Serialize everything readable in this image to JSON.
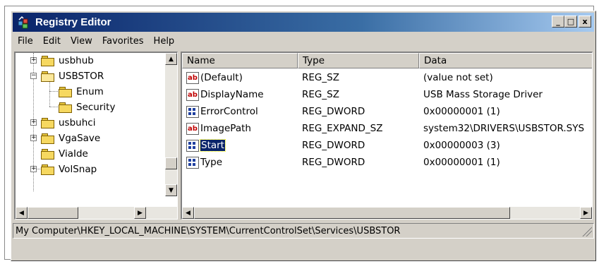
{
  "window": {
    "title": "Registry Editor"
  },
  "title_buttons": {
    "minimize": "_",
    "maximize": "□",
    "close": "x"
  },
  "menu": [
    "File",
    "Edit",
    "View",
    "Favorites",
    "Help"
  ],
  "tree": [
    {
      "label": "usbhub",
      "expander": "+"
    },
    {
      "label": "USBSTOR",
      "expander": "−"
    },
    {
      "label": "Enum",
      "expander": ""
    },
    {
      "label": "Security",
      "expander": ""
    },
    {
      "label": "usbuhci",
      "expander": "+"
    },
    {
      "label": "VgaSave",
      "expander": "+"
    },
    {
      "label": "ViaIde",
      "expander": ""
    },
    {
      "label": "VolSnap",
      "expander": "+"
    }
  ],
  "list": {
    "columns": [
      "Name",
      "Type",
      "Data"
    ],
    "rows": [
      {
        "icon": "string-value-icon",
        "name": "(Default)",
        "type": "REG_SZ",
        "data": "(value not set)"
      },
      {
        "icon": "string-value-icon",
        "name": "DisplayName",
        "type": "REG_SZ",
        "data": "USB Mass Storage Driver"
      },
      {
        "icon": "binary-value-icon",
        "name": "ErrorControl",
        "type": "REG_DWORD",
        "data": "0x00000001 (1)"
      },
      {
        "icon": "string-value-icon",
        "name": "ImagePath",
        "type": "REG_EXPAND_SZ",
        "data": "system32\\DRIVERS\\USBSTOR.SYS"
      },
      {
        "icon": "binary-value-icon",
        "name": "Start",
        "type": "REG_DWORD",
        "data": "0x00000003 (3)",
        "selected": true
      },
      {
        "icon": "binary-value-icon",
        "name": "Type",
        "type": "REG_DWORD",
        "data": "0x00000001 (1)"
      }
    ],
    "string_icon_text": "ab"
  },
  "status": {
    "path": "My Computer\\HKEY_LOCAL_MACHINE\\SYSTEM\\CurrentControlSet\\Services\\USBSTOR"
  },
  "scroll": {
    "up": "▲",
    "down": "▼",
    "left": "◀",
    "right": "▶"
  },
  "colors": {
    "title_start": "#0a246a",
    "title_end": "#a6caf0",
    "selection": "#0a246a",
    "face": "#d4d0c8"
  }
}
